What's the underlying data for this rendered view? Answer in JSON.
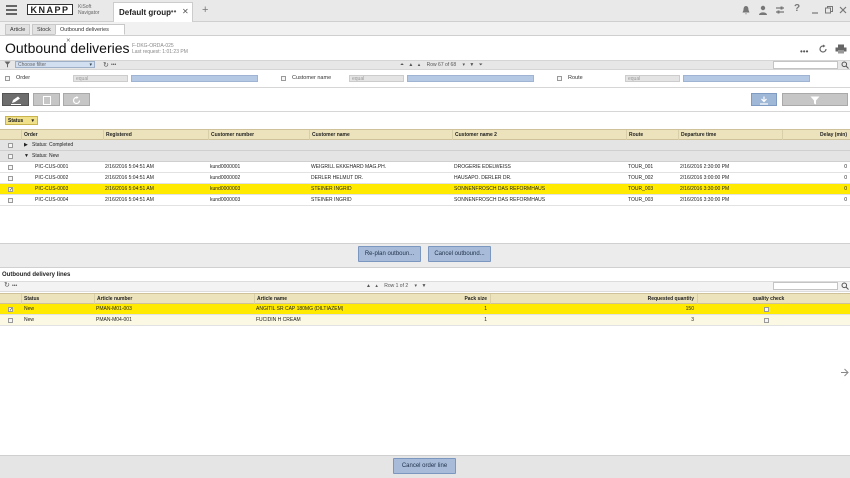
{
  "topbar": {
    "logo": "KNAPP",
    "logo_sub1": "KiSoft",
    "logo_sub2": "Navigator",
    "group_tab": "Default group",
    "group_dots": "•••",
    "group_close": "✕",
    "add_tab": "+"
  },
  "tabs": [
    {
      "label": "Article"
    },
    {
      "label": "Stock"
    },
    {
      "label": "Outbound deliveries",
      "close": "✕"
    }
  ],
  "page": {
    "title": "Outbound deliveries",
    "id": "F-DKG-ORDA-025",
    "last_request": "Last request: 1:01:23 PM",
    "more": "•••"
  },
  "filter": {
    "choose_placeholder": "Choose filter",
    "more": "•••",
    "row_counter": "Row 67 of 68"
  },
  "criteria": [
    {
      "label": "Order",
      "op": "equal"
    },
    {
      "label": "Customer name",
      "op": "equal"
    },
    {
      "label": "Route",
      "op": "equal"
    }
  ],
  "status_pill": "Status",
  "orders": {
    "headers": [
      "Order",
      "Registered",
      "Customer number",
      "Customer name",
      "Customer name 2",
      "Route",
      "Departure time",
      "Delay (min)"
    ],
    "group_completed": "Status: Completed",
    "group_new": "Status: New",
    "rows": [
      {
        "order": "PIC-CUS-0001",
        "registered": "2/16/2016 5:04:51 AM",
        "cust_no": "kund0000001",
        "cust_name": "WEIGRILL EKKEHARD MAG.PH.",
        "cust_name2": "DROGERIE EDELWEISS",
        "route": "TOUR_001",
        "departure": "2/16/2016 2:30:00 PM",
        "delay": "0",
        "selected": false
      },
      {
        "order": "PIC-CUS-0002",
        "registered": "2/16/2016 5:04:51 AM",
        "cust_no": "kund0000002",
        "cust_name": "DERLER HELMUT DR.",
        "cust_name2": "HAUSAPO.    DERLER DR.",
        "route": "TOUR_002",
        "departure": "2/16/2016 3:00:00 PM",
        "delay": "0",
        "selected": false
      },
      {
        "order": "PIC-CUS-0003",
        "registered": "2/16/2016 5:04:51 AM",
        "cust_no": "kund0000003",
        "cust_name": "STEINER INGRID",
        "cust_name2": "SONNENFROSCH DAS REFORMHAUS",
        "route": "TOUR_003",
        "departure": "2/16/2016 3:30:00 PM",
        "delay": "0",
        "selected": true
      },
      {
        "order": "PIC-CUS-0004",
        "registered": "2/16/2016 5:04:51 AM",
        "cust_no": "kund0000003",
        "cust_name": "STEINER INGRID",
        "cust_name2": "SONNENFROSCH DAS REFORMHAUS",
        "route": "TOUR_003",
        "departure": "2/16/2016 3:30:00 PM",
        "delay": "0",
        "selected": false
      }
    ]
  },
  "actions": {
    "replan": "Re-plan outboun...",
    "cancel": "Cancel outbound..."
  },
  "lines": {
    "section_title": "Outbound delivery lines",
    "more": "•••",
    "row_counter": "Row 1 of 2",
    "headers": [
      "Status",
      "Article number",
      "Article name",
      "Pack size",
      "Requested quantity",
      "quality check"
    ],
    "rows": [
      {
        "status": "New",
        "article_no": "PMAN-M01-003",
        "article_name": "ANGITIL SR CAP 180MG (DILTIAZEM)",
        "pack": "1",
        "qty": "150",
        "selected": true
      },
      {
        "status": "New",
        "article_no": "PMAN-M04-001",
        "article_name": "FUCIDIN H CREAM",
        "pack": "1",
        "qty": "3",
        "selected": false
      }
    ]
  },
  "bottom": {
    "cancel_line": "Cancel order line"
  },
  "colors": {
    "selection": "#ffea00",
    "header": "#ece3bc",
    "button": "#a8bcd9"
  }
}
